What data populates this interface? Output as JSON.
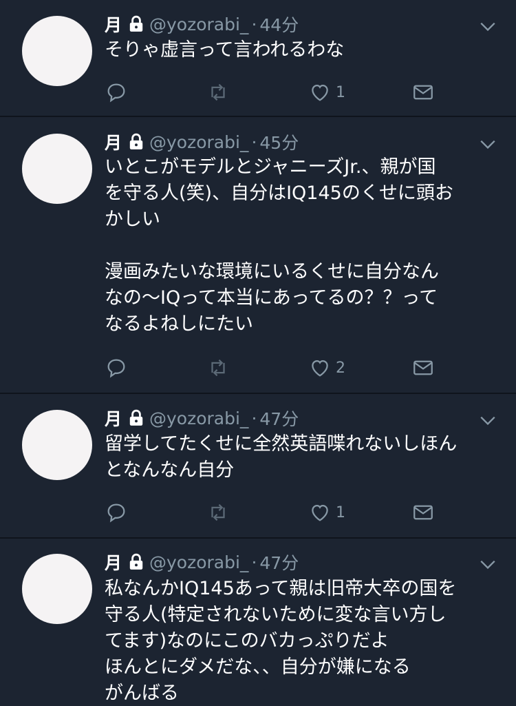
{
  "tweets": [
    {
      "name": "月",
      "handle": "@yozorabi_",
      "dot": "·",
      "time": "44分",
      "text": "そりゃ虚言って言われるわな",
      "like_count": "1"
    },
    {
      "name": "月",
      "handle": "@yozorabi_",
      "dot": "·",
      "time": "45分",
      "text": "いとこがモデルとジャニーズJr.、親が国\nを守る人(笑)、自分はIQ145のくせに頭お\nかしい\n\n漫画みたいな環境にいるくせに自分なん\nなの〜IQって本当にあってるの？？って\nなるよねしにたい",
      "like_count": "2"
    },
    {
      "name": "月",
      "handle": "@yozorabi_",
      "dot": "·",
      "time": "47分",
      "text": "留学してたくせに全然英語喋れないしほん\nとなんなん自分",
      "like_count": "1"
    },
    {
      "name": "月",
      "handle": "@yozorabi_",
      "dot": "·",
      "time": "47分",
      "text": "私なんかIQ145あって親は旧帝大卒の国を\n守る人(特定されないために変な言い方し\nてます)なのにこのバカっぷりだよ\nほんとにダメだな、、自分が嫌になる\nがんばる",
      "like_count": ""
    }
  ],
  "icons": {
    "lock": "lock-icon",
    "chevron": "chevron-down-icon",
    "reply": "reply-icon",
    "retweet": "retweet-icon",
    "like": "heart-icon",
    "dm": "direct-message-icon"
  },
  "colors": {
    "background": "#1c2431",
    "divider": "#0f141c",
    "secondary_text": "#8899a6",
    "primary_text": "#ffffff",
    "avatar": "#f5f3f4"
  }
}
